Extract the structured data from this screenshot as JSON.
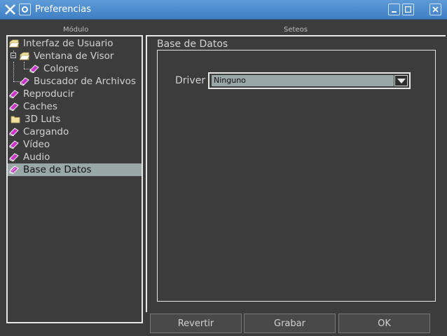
{
  "window": {
    "title": "Preferencias"
  },
  "groups": {
    "module_label": "Módulo",
    "settings_label": "Seteos"
  },
  "tree": {
    "items": [
      {
        "label": "Interfaz de Usuario",
        "icon": "folder-open-icon"
      },
      {
        "label": "Ventana de Visor",
        "icon": "folder-open-icon"
      },
      {
        "label": "Colores",
        "icon": "book-icon"
      },
      {
        "label": "Buscador de Archivos",
        "icon": "book-icon"
      },
      {
        "label": "Reproducir",
        "icon": "book-icon"
      },
      {
        "label": "Caches",
        "icon": "book-icon"
      },
      {
        "label": "3D Luts",
        "icon": "folder-icon"
      },
      {
        "label": "Cargando",
        "icon": "book-icon"
      },
      {
        "label": "Vídeo",
        "icon": "book-icon"
      },
      {
        "label": "Audio",
        "icon": "book-icon"
      },
      {
        "label": "Base de Datos",
        "icon": "book-open-icon"
      }
    ],
    "selected": "Base de Datos"
  },
  "settings": {
    "section_title": "Base de Datos",
    "driver_label": "Driver",
    "driver_value": "Ninguno"
  },
  "buttons": {
    "revert": "Revertir",
    "save": "Grabar",
    "ok": "OK"
  },
  "colors": {
    "titlebar": "#4a8bd0",
    "background": "#3c3c3c",
    "selection": "#9aa7a7",
    "book_icon": "#cc33cc",
    "folder_icon": "#f0e0a0"
  }
}
